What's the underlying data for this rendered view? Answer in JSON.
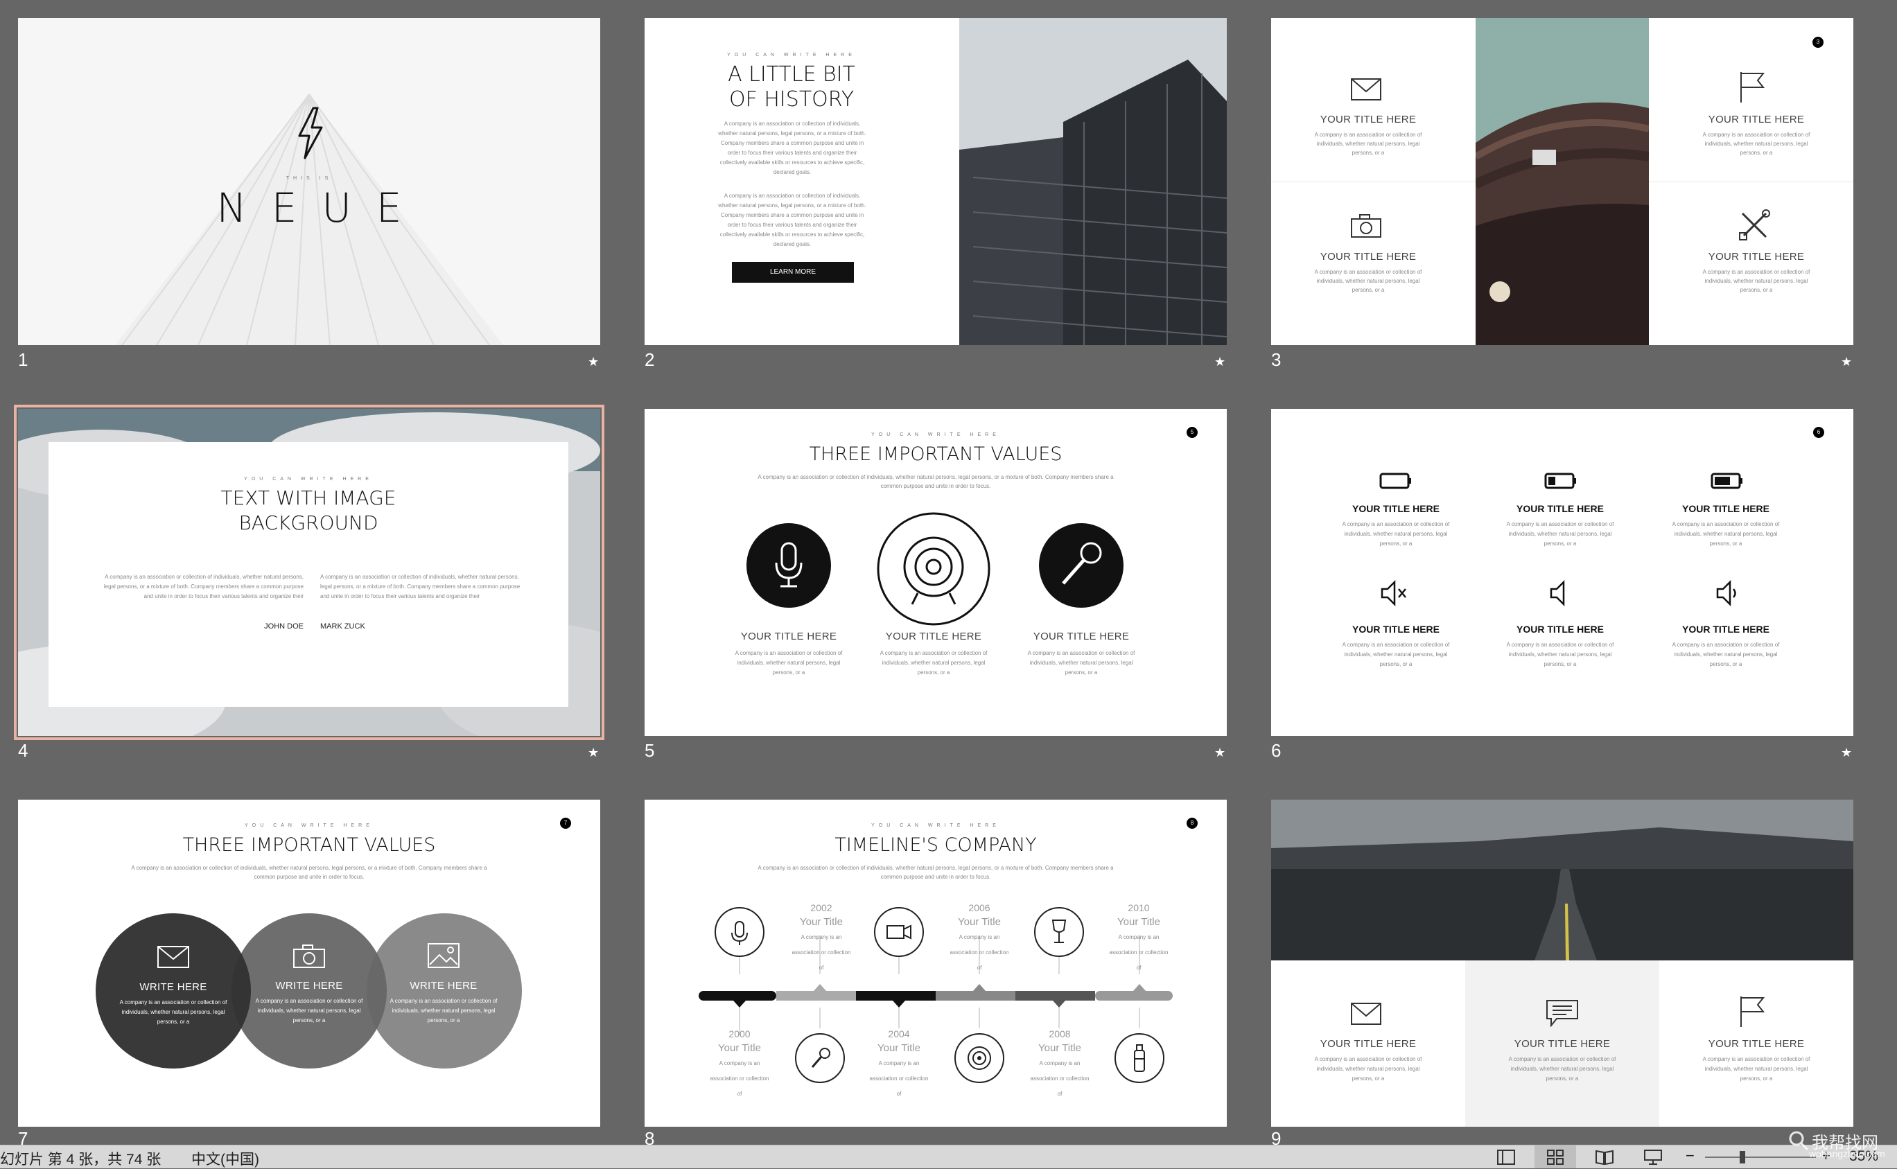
{
  "colors": {
    "background": "#666666",
    "selection": "#e8b3a3",
    "dark": "#333333",
    "mid": "#666666",
    "light": "#888888"
  },
  "slides": [
    {
      "number": "1",
      "kicker": "THIS IS",
      "title": "NEUE",
      "icon": "lightning-icon"
    },
    {
      "number": "2",
      "kicker": "YOU CAN WRITE HERE",
      "title_line1": "A LITTLE BIT",
      "title_line2": "OF HISTORY",
      "para1": "A company is an association or collection of individuals, whether natural persons, legal persons, or a mixture of both. Company members share a common purpose and unite in order to focus their various talents and organize their collectively available skills or resources to achieve specific, declared goals.",
      "para2": "A company is an association or collection of individuals, whether natural persons, legal persons, or a mixture of both. Company members share a common purpose and unite in order to focus their various talents and organize their collectively available skills or resources to achieve specific, declared goals.",
      "button": "LEARN MORE"
    },
    {
      "number": "3",
      "page": "3",
      "items": [
        {
          "icon": "envelope-icon",
          "title": "YOUR TITLE HERE",
          "text": "A company is an association or collection of individuals, whether natural persons, legal persons, or a"
        },
        {
          "icon": "flag-icon",
          "title": "YOUR TITLE HERE",
          "text": "A company is an association or collection of individuals, whether natural persons, legal persons, or a"
        },
        {
          "icon": "camera-icon",
          "title": "YOUR TITLE HERE",
          "text": "A company is an association or collection of individuals, whether natural persons, legal persons, or a"
        },
        {
          "icon": "tools-icon",
          "title": "YOUR TITLE HERE",
          "text": "A company is an association or collection of individuals, whether natural persons, legal persons, or a"
        }
      ]
    },
    {
      "number": "4",
      "kicker": "YOU CAN WRITE HERE",
      "title_line1": "TEXT WITH IMAGE",
      "title_line2": "BACKGROUND",
      "left_text": "A company is an association or collection of individuals, whether natural persons, legal persons, or a mixture of both. Company members share a common purpose and unite in order to focus their various talents and organize their",
      "left_name": "JOHN DOE",
      "right_text": "A company is an association or collection of individuals, whether natural persons, legal persons, or a mixture of both. Company members share a common purpose and unite in order to focus their various talents and organize their",
      "right_name": "MARK ZUCK"
    },
    {
      "number": "5",
      "page": "5",
      "kicker": "YOU CAN WRITE HERE",
      "title": "THREE IMPORTANT VALUES",
      "subtitle": "A company is an association or collection of individuals, whether natural persons, legal persons, or a mixture of both. Company members share a common purpose and unite in order to focus.",
      "items": [
        {
          "icon": "microphone-icon",
          "title": "YOUR TITLE HERE",
          "text": "A company is an association or collection of individuals, whether natural persons, legal persons, or a"
        },
        {
          "icon": "target-icon",
          "title": "YOUR TITLE HERE",
          "text": "A company is an association or collection of individuals, whether natural persons, legal persons, or a"
        },
        {
          "icon": "handheld-mic-icon",
          "title": "YOUR TITLE HERE",
          "text": "A company is an association or collection of individuals, whether natural persons, legal persons, or a"
        }
      ]
    },
    {
      "number": "6",
      "page": "6",
      "items": [
        {
          "icon": "battery-empty-icon",
          "title": "YOUR TITLE HERE",
          "text": "A company is an association or collection of individuals, whether natural persons, legal persons, or a"
        },
        {
          "icon": "battery-low-icon",
          "title": "YOUR TITLE HERE",
          "text": "A company is an association or collection of individuals, whether natural persons, legal persons, or a"
        },
        {
          "icon": "battery-half-icon",
          "title": "YOUR TITLE HERE",
          "text": "A company is an association or collection of individuals, whether natural persons, legal persons, or a"
        },
        {
          "icon": "speaker-mute-icon",
          "title": "YOUR TITLE HERE",
          "text": "A company is an association or collection of individuals, whether natural persons, legal persons, or a"
        },
        {
          "icon": "speaker-icon",
          "title": "YOUR TITLE HERE",
          "text": "A company is an association or collection of individuals, whether natural persons, legal persons, or a"
        },
        {
          "icon": "speaker-low-icon",
          "title": "YOUR TITLE HERE",
          "text": "A company is an association or collection of individuals, whether natural persons, legal persons, or a"
        }
      ]
    },
    {
      "number": "7",
      "page": "7",
      "kicker": "YOU CAN WRITE HERE",
      "title": "THREE IMPORTANT VALUES",
      "subtitle": "A company is an association or collection of individuals, whether natural persons, legal persons, or a mixture of both. Company members share a common purpose and unite in order to focus.",
      "items": [
        {
          "icon": "envelope-icon",
          "title": "WRITE HERE",
          "text": "A company is an association or collection of individuals, whether natural persons, legal persons, or a"
        },
        {
          "icon": "camera-icon",
          "title": "WRITE HERE",
          "text": "A company is an association or collection of individuals, whether natural persons, legal persons, or a"
        },
        {
          "icon": "image-icon",
          "title": "WRITE HERE",
          "text": "A company is an association or collection of individuals, whether natural persons, legal persons, or a"
        }
      ]
    },
    {
      "number": "8",
      "page": "8",
      "kicker": "YOU CAN WRITE HERE",
      "title": "TIMELINE'S COMPANY",
      "subtitle": "A company is an association or collection of individuals, whether natural persons, legal persons, or a mixture of both. Company members share a common purpose and unite in order to focus.",
      "top": [
        {
          "year": "2002",
          "title": "Your Title",
          "text": "A company is an association or collection of"
        },
        {
          "year": "2006",
          "title": "Your Title",
          "text": "A company is an association or collection of"
        },
        {
          "year": "2010",
          "title": "Your Title",
          "text": "A company is an association or collection of"
        }
      ],
      "bottom": [
        {
          "year": "2000",
          "title": "Your Title",
          "text": "A company is an association or collection of"
        },
        {
          "year": "2004",
          "title": "Your Title",
          "text": "A company is an association or collection of"
        },
        {
          "year": "2008",
          "title": "Your Title",
          "text": "A company is an association or collection of"
        }
      ]
    },
    {
      "number": "9",
      "items": [
        {
          "icon": "envelope-icon",
          "title": "YOUR TITLE HERE",
          "text": "A company is an association or collection of individuals, whether natural persons, legal persons, or a"
        },
        {
          "icon": "chat-icon",
          "title": "YOUR TITLE HERE",
          "text": "A company is an association or collection of individuals, whether natural persons, legal persons, or a"
        },
        {
          "icon": "flag-icon",
          "title": "YOUR TITLE HERE",
          "text": "A company is an association or collection of individuals, whether natural persons, legal persons, or a"
        }
      ]
    }
  ],
  "status": {
    "slide_info": "幻灯片 第 4 张，共 74 张",
    "language": "中文(中国)",
    "zoom": "35%",
    "watermark_cn": "我帮找网",
    "watermark_url": "wobangzhao.com"
  }
}
